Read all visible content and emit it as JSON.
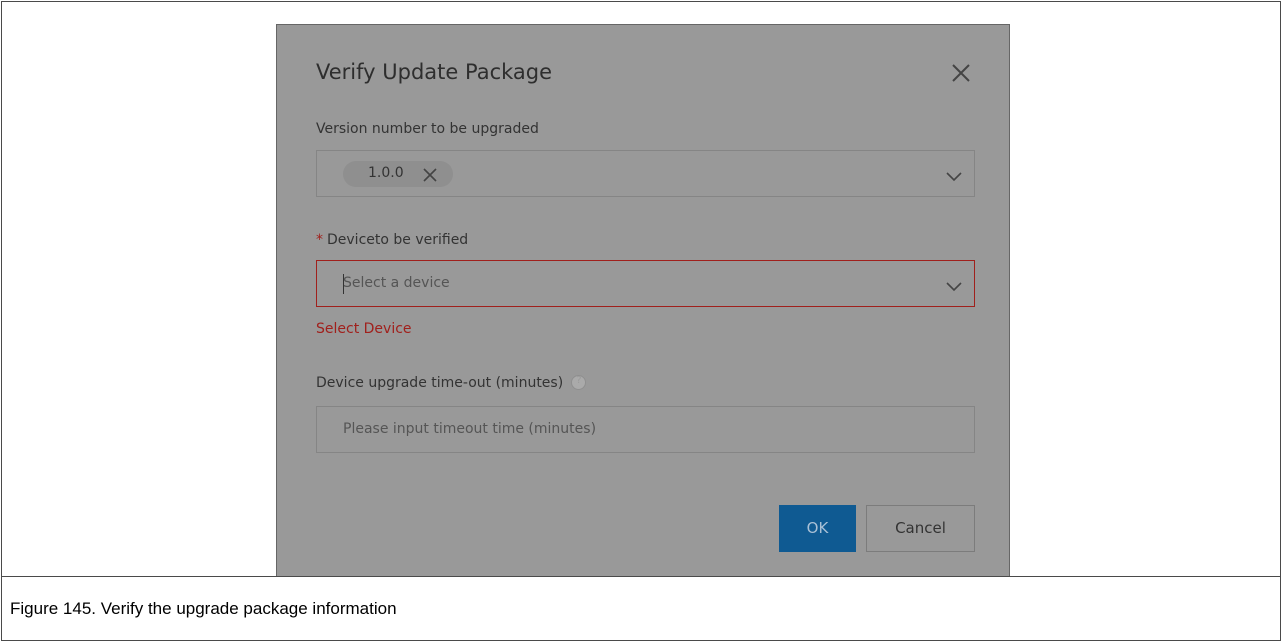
{
  "dialog": {
    "title": "Verify Update Package",
    "version_label": "Version number to be upgraded",
    "version_tag": "1.0.0",
    "device_required_mark": "*",
    "device_label": "Deviceto be verified",
    "device_placeholder": "Select a device",
    "device_error": "Select Device",
    "timeout_label": "Device upgrade time-out (minutes)",
    "timeout_placeholder": "Please input timeout time (minutes)",
    "ok_label": "OK",
    "cancel_label": "Cancel"
  },
  "caption": "Figure 145.  Verify the upgrade package information",
  "colors": {
    "overlay": "#999999",
    "primary_button": "#0f5a92",
    "error": "#a0201c"
  },
  "icons": [
    "close-icon",
    "tag-remove-icon",
    "chevron-down-icon",
    "help-icon"
  ]
}
